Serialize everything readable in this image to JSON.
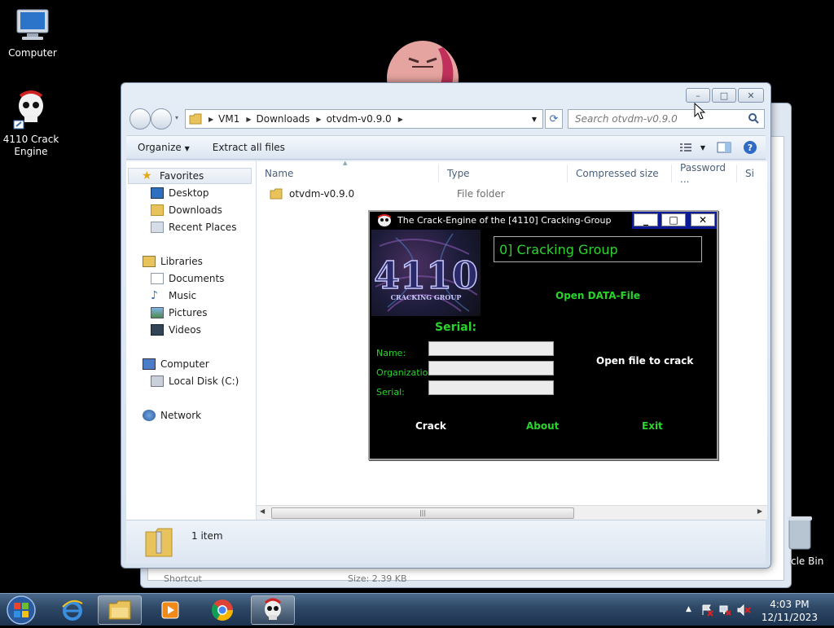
{
  "desktop": {
    "icons": [
      {
        "label": "Computer"
      },
      {
        "label": "4110 Crack Engine"
      },
      {
        "label": "cle Bin"
      }
    ]
  },
  "back_window": {
    "status_left": "Shortcut",
    "status_right": "Size: 2.39 KB"
  },
  "explorer": {
    "controls": {
      "minimize": "–",
      "maximize": "□",
      "close": "✕"
    },
    "breadcrumb": [
      "VM1",
      "Downloads",
      "otvdm-v0.9.0"
    ],
    "search_placeholder": "Search otvdm-v0.9.0",
    "toolbar": {
      "organize": "Organize",
      "extract_all": "Extract all files"
    },
    "nav": {
      "favorites": "Favorites",
      "desktop": "Desktop",
      "downloads": "Downloads",
      "recent_places": "Recent Places",
      "libraries": "Libraries",
      "documents": "Documents",
      "music": "Music",
      "pictures": "Pictures",
      "videos": "Videos",
      "computer": "Computer",
      "local_disk": "Local Disk (C:)",
      "network": "Network"
    },
    "columns": {
      "name": "Name",
      "type": "Type",
      "compressed": "Compressed size",
      "password": "Password ...",
      "size": "Si"
    },
    "rows": [
      {
        "name": "otvdm-v0.9.0",
        "type": "File folder"
      }
    ],
    "item_count": "1 item"
  },
  "crack_engine": {
    "title": "The Crack-Engine of the [4110] Cracking-Group",
    "logo_text": "4110",
    "logo_subtext": "CRACKING GROUP",
    "group_field": "0] Cracking Group",
    "open_data_file": "Open DATA-File",
    "serial_heading": "Serial:",
    "labels": {
      "name": "Name:",
      "organization": "Organization:",
      "serial": "Serial:"
    },
    "open_file_to_crack": "Open file to crack",
    "buttons": {
      "crack": "Crack",
      "about": "About",
      "exit": "Exit"
    },
    "colors": {
      "accent_green": "#27d62a"
    }
  },
  "taskbar": {
    "time": "4:03 PM",
    "date": "12/11/2023"
  }
}
